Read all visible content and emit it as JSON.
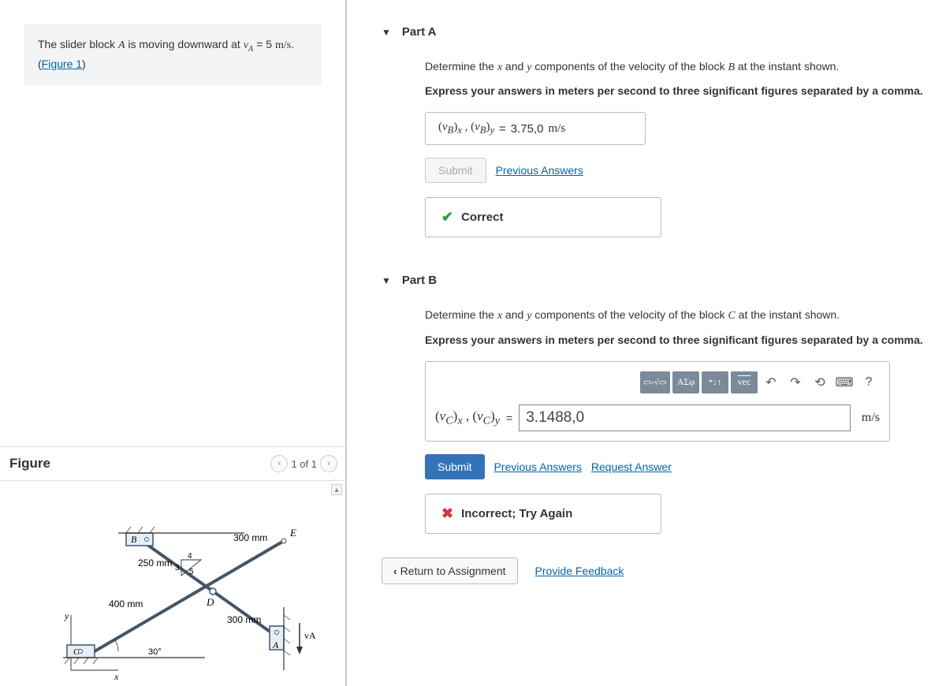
{
  "problem": {
    "pre": "The slider block ",
    "var1": "A",
    "mid1": " is moving downward at ",
    "vAlabel": "v",
    "vAsub": "A",
    "eq": " = 5 ",
    "unit": "m/s",
    "post": ".",
    "figref_pre": "(",
    "figref": "Figure 1",
    "figref_post": ")"
  },
  "figure": {
    "title": "Figure",
    "counter": "1 of 1",
    "labels": {
      "B": "B",
      "E": "E",
      "D": "D",
      "A": "A",
      "C": "C",
      "y": "y",
      "x": "x",
      "vA": "vA",
      "d250": "250 mm",
      "d300a": "300 mm",
      "d300b": "300 mm",
      "d400": "400 mm",
      "ang30": "30°",
      "n3": "3",
      "n4": "4",
      "n5": "5"
    }
  },
  "partA": {
    "title": "Part A",
    "instr_pre": "Determine the ",
    "x": "x",
    "and": " and ",
    "y": "y",
    "instr_mid": " components of the velocity of the block ",
    "block": "B",
    "instr_post": " at the instant shown.",
    "instr2": "Express your answers in meters per second to three significant figures separated by a comma.",
    "lhs": "(vB)x , (vB)y",
    "equals": " =",
    "value": " 3.75,0 ",
    "unit": "m/s",
    "submit": "Submit",
    "prev": "Previous Answers",
    "correct": "Correct"
  },
  "partB": {
    "title": "Part B",
    "instr_pre": "Determine the ",
    "x": "x",
    "and": " and ",
    "y": "y",
    "instr_mid": " components of the velocity of the block ",
    "block": "C",
    "instr_post": " at the instant shown.",
    "instr2": "Express your answers in meters per second to three significant figures separated by a comma.",
    "tool_greek": "ΑΣφ",
    "tool_vec": "vec",
    "lhs": "(vC)x , (vC)y",
    "equals": " = ",
    "value": "3.1488,0",
    "unit": "m/s",
    "submit": "Submit",
    "prev": "Previous Answers",
    "req": "Request Answer",
    "incorrect": "Incorrect; Try Again"
  },
  "footer": {
    "return": "Return to Assignment",
    "feedback": "Provide Feedback"
  }
}
